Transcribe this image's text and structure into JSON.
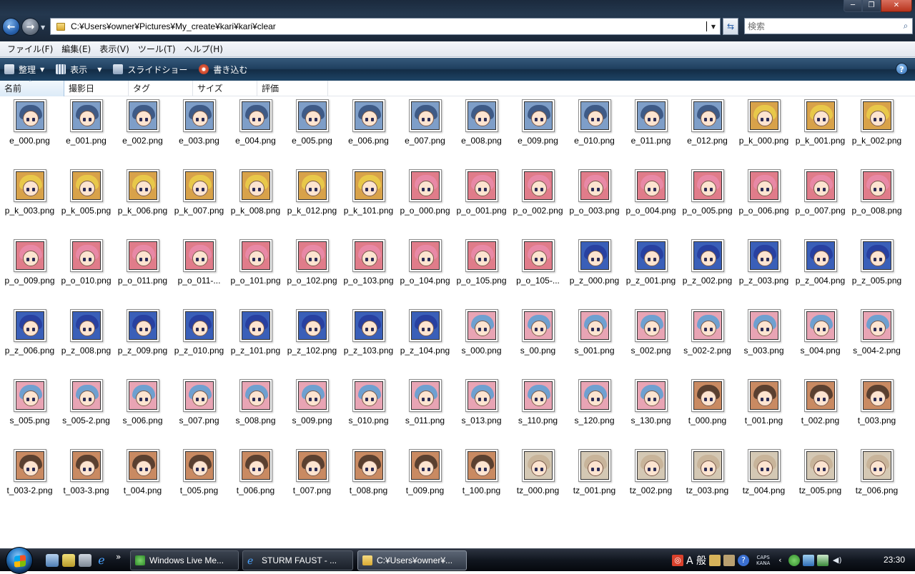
{
  "window": {
    "minimize_label": "─",
    "maximize_label": "❐",
    "close_label": "✕"
  },
  "nav": {
    "address": "C:¥Users¥owner¥Pictures¥My_create¥kari¥kari¥clear",
    "search_placeholder": "検索"
  },
  "menu": [
    "ファイル(F)",
    "編集(E)",
    "表示(V)",
    "ツール(T)",
    "ヘルプ(H)"
  ],
  "commands": {
    "organize": "整理",
    "view": "表示",
    "slideshow": "スライドショー",
    "burn": "書き込む",
    "help": "?"
  },
  "columns": [
    "名前",
    "撮影日",
    "タグ",
    "サイズ",
    "評価"
  ],
  "files": [
    "e_000.png",
    "e_001.png",
    "e_002.png",
    "e_003.png",
    "e_004.png",
    "e_005.png",
    "e_006.png",
    "e_007.png",
    "e_008.png",
    "e_009.png",
    "e_010.png",
    "e_011.png",
    "e_012.png",
    "p_k_000.png",
    "p_k_001.png",
    "p_k_002.png",
    "p_k_003.png",
    "p_k_005.png",
    "p_k_006.png",
    "p_k_007.png",
    "p_k_008.png",
    "p_k_012.png",
    "p_k_101.png",
    "p_o_000.png",
    "p_o_001.png",
    "p_o_002.png",
    "p_o_003.png",
    "p_o_004.png",
    "p_o_005.png",
    "p_o_006.png",
    "p_o_007.png",
    "p_o_008.png",
    "p_o_009.png",
    "p_o_010.png",
    "p_o_011.png",
    "p_o_011-...",
    "p_o_101.png",
    "p_o_102.png",
    "p_o_103.png",
    "p_o_104.png",
    "p_o_105.png",
    "p_o_105-...",
    "p_z_000.png",
    "p_z_001.png",
    "p_z_002.png",
    "p_z_003.png",
    "p_z_004.png",
    "p_z_005.png",
    "p_z_006.png",
    "p_z_008.png",
    "p_z_009.png",
    "p_z_010.png",
    "p_z_101.png",
    "p_z_102.png",
    "p_z_103.png",
    "p_z_104.png",
    "s_000.png",
    "s_00.png",
    "s_001.png",
    "s_002.png",
    "s_002-2.png",
    "s_003.png",
    "s_004.png",
    "s_004-2.png",
    "s_005.png",
    "s_005-2.png",
    "s_006.png",
    "s_007.png",
    "s_008.png",
    "s_009.png",
    "s_010.png",
    "s_011.png",
    "s_013.png",
    "s_110.png",
    "s_120.png",
    "s_130.png",
    "t_000.png",
    "t_001.png",
    "t_002.png",
    "t_003.png",
    "t_003-2.png",
    "t_003-3.png",
    "t_004.png",
    "t_005.png",
    "t_006.png",
    "t_007.png",
    "t_008.png",
    "t_009.png",
    "t_100.png",
    "tz_000.png",
    "tz_001.png",
    "tz_002.png",
    "tz_003.png",
    "tz_004.png",
    "tz_005.png",
    "tz_006.png"
  ],
  "palette": {
    "e": {
      "bg": "#7e9ec8",
      "hair": "#3e5a86"
    },
    "p_k": {
      "bg": "#d8a24a",
      "hair": "#e8c84a"
    },
    "p_o": {
      "bg": "#e07c8a",
      "hair": "#e889a6"
    },
    "p_z": {
      "bg": "#3a5fb8",
      "hair": "#2840a0"
    },
    "s": {
      "bg": "#e8a4b4",
      "hair": "#6fa0d0"
    },
    "t": {
      "bg": "#c98a62",
      "hair": "#5a4030"
    },
    "tz": {
      "bg": "#d4c8b4",
      "hair": "#c8b49a"
    }
  },
  "taskbar": {
    "tasks": [
      "Windows Live Me...",
      "STURM FAUST - ...",
      "C:¥Users¥owner¥..."
    ],
    "quicklaunch_more": "»",
    "ime_label": "A 般",
    "caps_label": "CAPS",
    "kana_label": "KANA",
    "clock": "23:30"
  }
}
